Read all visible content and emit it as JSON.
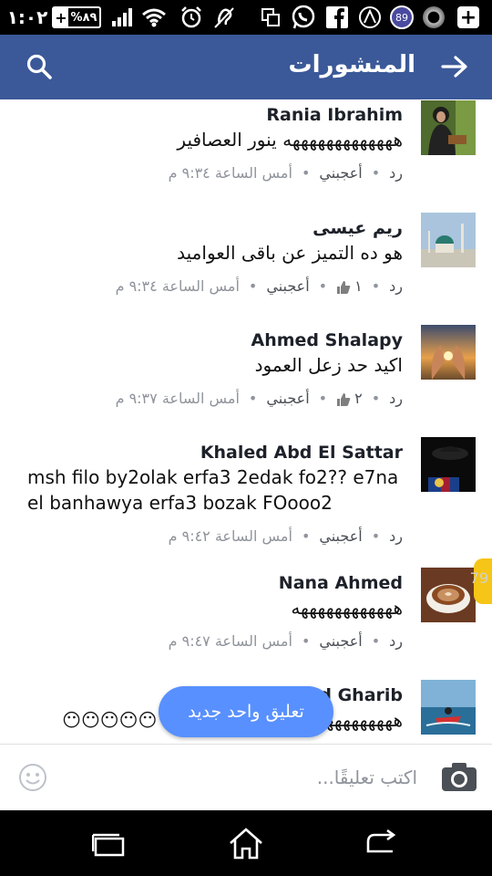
{
  "status_bar": {
    "time": "١:٠٢",
    "battery": "%٨٩",
    "notification_badge": "89",
    "icons": [
      "battery-icon",
      "signal-icon",
      "wifi-icon",
      "alarm-icon",
      "hearing-icon",
      "screenshot-icon",
      "whatsapp-icon",
      "facebook-icon",
      "bike-icon",
      "notification-badge-icon",
      "circle-app-icon",
      "add-icon"
    ]
  },
  "header": {
    "title": "المنشورات",
    "back_icon": "arrow-right-icon",
    "search_icon": "search-icon",
    "background": "#3b5998"
  },
  "comments": [
    {
      "author": "Rania Ibrahim",
      "text": "هههههههههههههه ينور العصافير",
      "reply": "رد",
      "like": "أعجبني",
      "time": "أمس الساعة ٩:٣٤ م",
      "likes": ""
    },
    {
      "author": "ريم عيسى",
      "text": "هو ده التميز عن باقى العواميد",
      "reply": "رد",
      "like": "أعجبني",
      "time": "أمس الساعة ٩:٣٤ م",
      "likes": "١"
    },
    {
      "author": "Ahmed Shalapy",
      "text": "اكيد حد زعل العمود",
      "reply": "رد",
      "like": "أعجبني",
      "time": "أمس الساعة ٩:٣٧ م",
      "likes": "٢"
    },
    {
      "author": "Khaled Abd El Sattar",
      "text": "msh filo by2olak erfa3 2edak fo2?? e7na el banhawya erfa3 bozak FOooo2",
      "reply": "رد",
      "like": "أعجبني",
      "time": "أمس الساعة ٩:٤٢ م",
      "likes": ""
    },
    {
      "author": "Nana Ahmed",
      "text": "ههههههههههههه",
      "reply": "رد",
      "like": "أعجبني",
      "time": "أمس الساعة ٩:٤٧ م",
      "likes": ""
    },
    {
      "author": "Ahmed Gharib",
      "text": "هههههههههههه طيارات ده ولا ايه 😶😶😶😶😶",
      "reply": "",
      "like": "",
      "time": "",
      "likes": ""
    }
  ],
  "side_indicator": "79",
  "new_comment_pill": "تعليق واحد جديد",
  "composer": {
    "placeholder": "اكتب تعليقًا...",
    "camera_icon": "camera-icon",
    "emoji_icon": "emoji-icon"
  },
  "nav_bar": {
    "icons": [
      "recent-apps-icon",
      "home-icon",
      "back-icon"
    ]
  }
}
